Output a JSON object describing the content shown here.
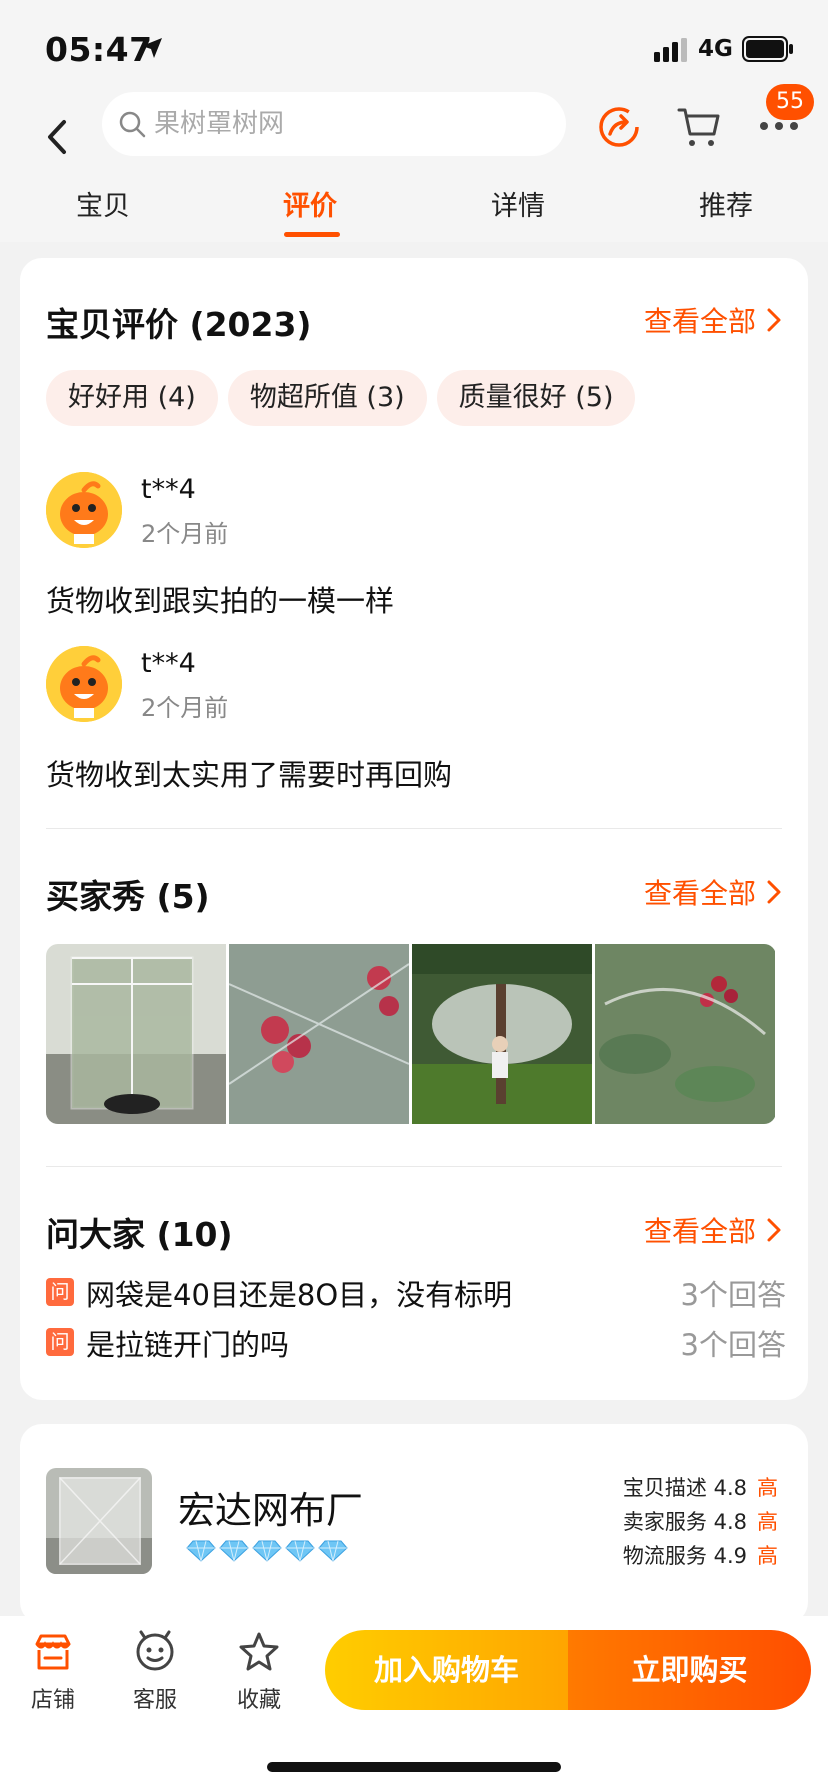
{
  "status_bar": {
    "time": "05:47",
    "network": "4G"
  },
  "search": {
    "placeholder": "果树罩树网"
  },
  "header": {
    "badge_count": "55"
  },
  "tabs": [
    {
      "label": "宝贝"
    },
    {
      "label": "评价"
    },
    {
      "label": "详情"
    },
    {
      "label": "推荐"
    }
  ],
  "reviews_section": {
    "title": "宝贝评价 (2023)",
    "see_all": "查看全部",
    "chips": [
      "好好用 (4)",
      "物超所值 (3)",
      "质量很好 (5)"
    ],
    "items": [
      {
        "user": "t**4",
        "time": "2个月前",
        "text": "货物收到跟实拍的一模一样"
      },
      {
        "user": "t**4",
        "time": "2个月前",
        "text": "货物收到太实用了需要时再回购"
      }
    ]
  },
  "buyer_show": {
    "title": "买家秀 (5)",
    "see_all": "查看全部"
  },
  "qa": {
    "title": "问大家 (10)",
    "see_all": "查看全部",
    "tag": "问",
    "items": [
      {
        "question": "网袋是40目还是8O目，没有标明",
        "answers": "3个回答"
      },
      {
        "question": "是拉链开门的吗",
        "answers": "3个回答"
      }
    ]
  },
  "shop": {
    "name": "宏达网布厂",
    "diamond_count": 5,
    "ratings": [
      {
        "label": "宝贝描述 4.8",
        "level": "高"
      },
      {
        "label": "卖家服务 4.8",
        "level": "高"
      },
      {
        "label": "物流服务 4.9",
        "level": "高"
      }
    ]
  },
  "bottom_bar": {
    "store": "店铺",
    "service": "客服",
    "favorite": "收藏",
    "add_to_cart": "加入购物车",
    "buy_now": "立即购买"
  },
  "colors": {
    "accent": "#ff5000",
    "chip_bg": "#fdeeea",
    "cart_button": "#ffb800",
    "buy_button": "#ff5a00"
  }
}
